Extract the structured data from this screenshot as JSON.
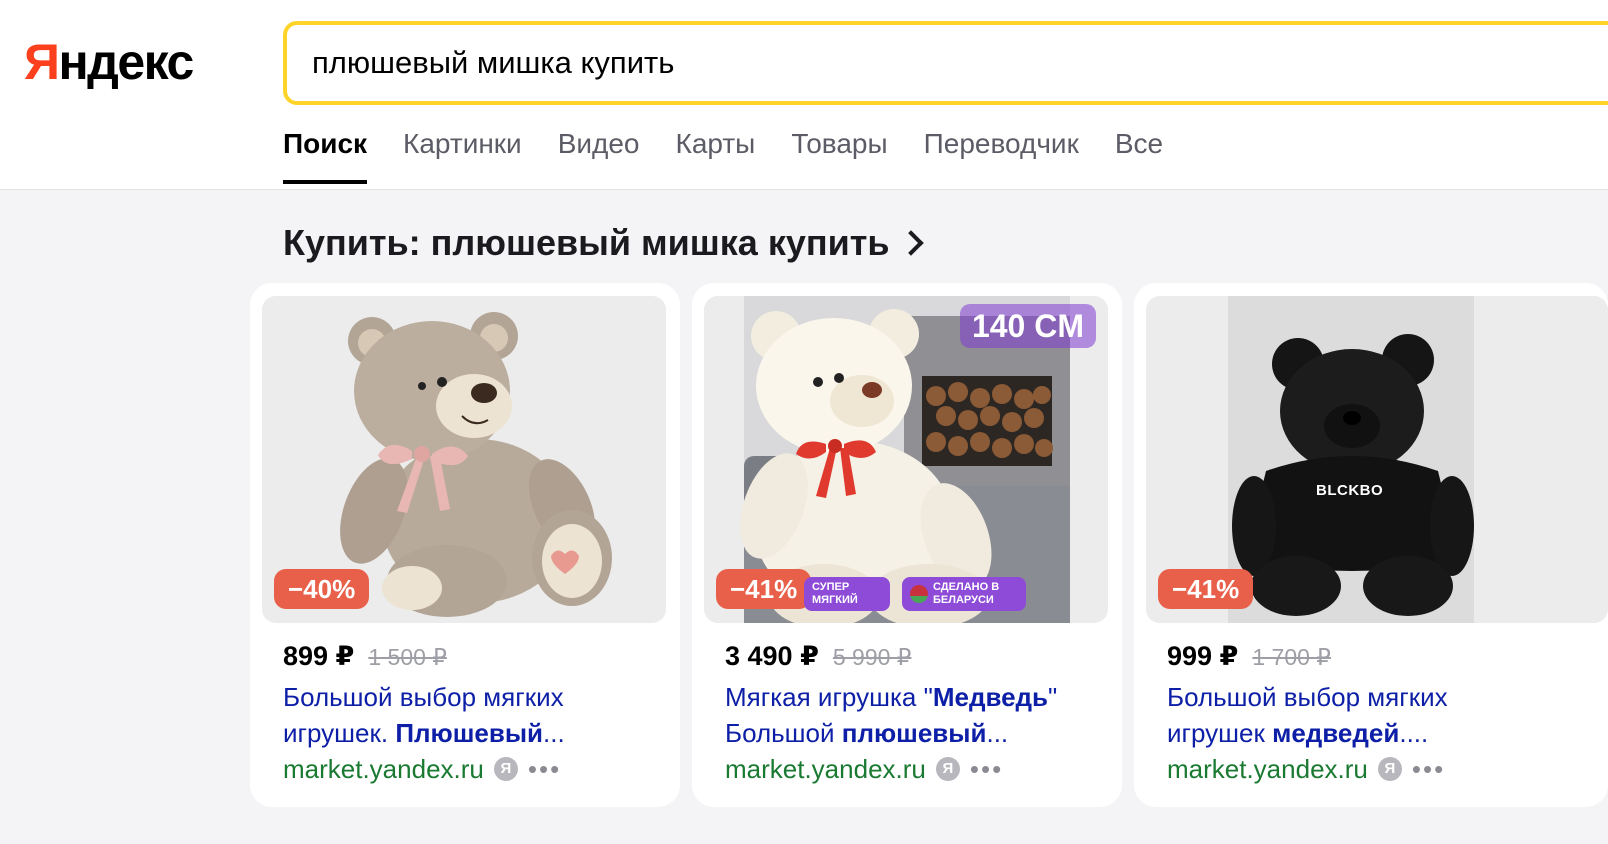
{
  "header": {
    "logo_first": "Я",
    "logo_rest": "ндекс",
    "search_query": "плюшевый мишка купить"
  },
  "tabs": [
    {
      "label": "Поиск",
      "active": true
    },
    {
      "label": "Картинки"
    },
    {
      "label": "Видео"
    },
    {
      "label": "Карты"
    },
    {
      "label": "Товары"
    },
    {
      "label": "Переводчик"
    },
    {
      "label": "Все"
    }
  ],
  "section": {
    "title": "Купить: плюшевый мишка купить"
  },
  "products": [
    {
      "discount": "−40%",
      "price": "899 ₽",
      "old_price": "1 500 ₽",
      "title_plain_1": "Большой выбор мягких игрушек. ",
      "title_bold": "Плюшевый",
      "title_plain_2": "...",
      "source": "market.yandex.ru",
      "ya": "Я",
      "more": "•••",
      "image": "beige-teddy-bear"
    },
    {
      "discount": "−41%",
      "size_label": "140 CM",
      "badge_1": "СУПЕР МЯГКИЙ",
      "badge_2": "СДЕЛАНО В БЕЛАРУСИ",
      "price": "3 490 ₽",
      "old_price": "5 990 ₽",
      "title_plain_1": "Мягкая игрушка \"",
      "title_bold": "Медведь",
      "title_plain_2": "\" Большой ",
      "title_bold_2": "плюшевый",
      "title_plain_3": "...",
      "source": "market.yandex.ru",
      "ya": "Я",
      "more": "•••",
      "image": "white-teddy-bear"
    },
    {
      "discount": "−41%",
      "hoodie_text": "BLCKBO",
      "price": "999 ₽",
      "old_price": "1 700 ₽",
      "title_plain_1": "Большой выбор мягких игрушек ",
      "title_bold": "медведей",
      "title_plain_2": "....",
      "source": "market.yandex.ru",
      "ya": "Я",
      "more": "•••",
      "image": "black-teddy-bear"
    }
  ],
  "colors": {
    "accent_yellow": "#fed42b",
    "logo_red": "#fc3f1d",
    "link_blue": "#0d1fa7",
    "source_green": "#1a7a32",
    "discount_red": "#e8604a"
  }
}
